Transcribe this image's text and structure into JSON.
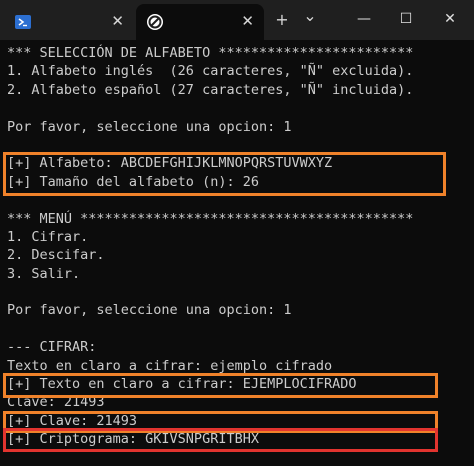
{
  "tabs": [
    {
      "kind": "powershell",
      "active": false
    },
    {
      "kind": "app",
      "active": true
    }
  ],
  "controls": {
    "close_glyph": "✕",
    "new_tab_glyph": "+",
    "dropdown_glyph": "⌄",
    "minimize_glyph": "—",
    "maximize_glyph": "☐",
    "window_close_glyph": "✕"
  },
  "colors": {
    "orange_highlight": "#f0822a",
    "red_highlight": "#e3342f",
    "terminal_bg": "#0c0c0c",
    "terminal_fg": "#cccccc"
  },
  "terminal": {
    "lines": [
      "*** SELECCIÓN DE ALFABETO ************************",
      "1. Alfabeto inglés  (26 caracteres, \"Ñ\" excluida).",
      "2. Alfabeto español (27 caracteres, \"Ñ\" incluida).",
      "",
      "Por favor, seleccione una opcion: 1",
      "",
      "[+] Alfabeto: ABCDEFGHIJKLMNOPQRSTUVWXYZ",
      "[+] Tamaño del alfabeto (n): 26",
      "",
      "*** MENÚ *****************************************",
      "1. Cifrar.",
      "2. Descifar.",
      "3. Salir.",
      "",
      "Por favor, seleccione una opcion: 1",
      "",
      "--- CIFRAR:",
      "Texto en claro a cifrar: ejemplo cifrado",
      "[+] Texto en claro a cifrar: EJEMPLOCIFRADO",
      "Clave: 21493",
      "[+] Clave: 21493",
      "[+] Criptograma: GKIVSNPGRITBHX"
    ]
  }
}
